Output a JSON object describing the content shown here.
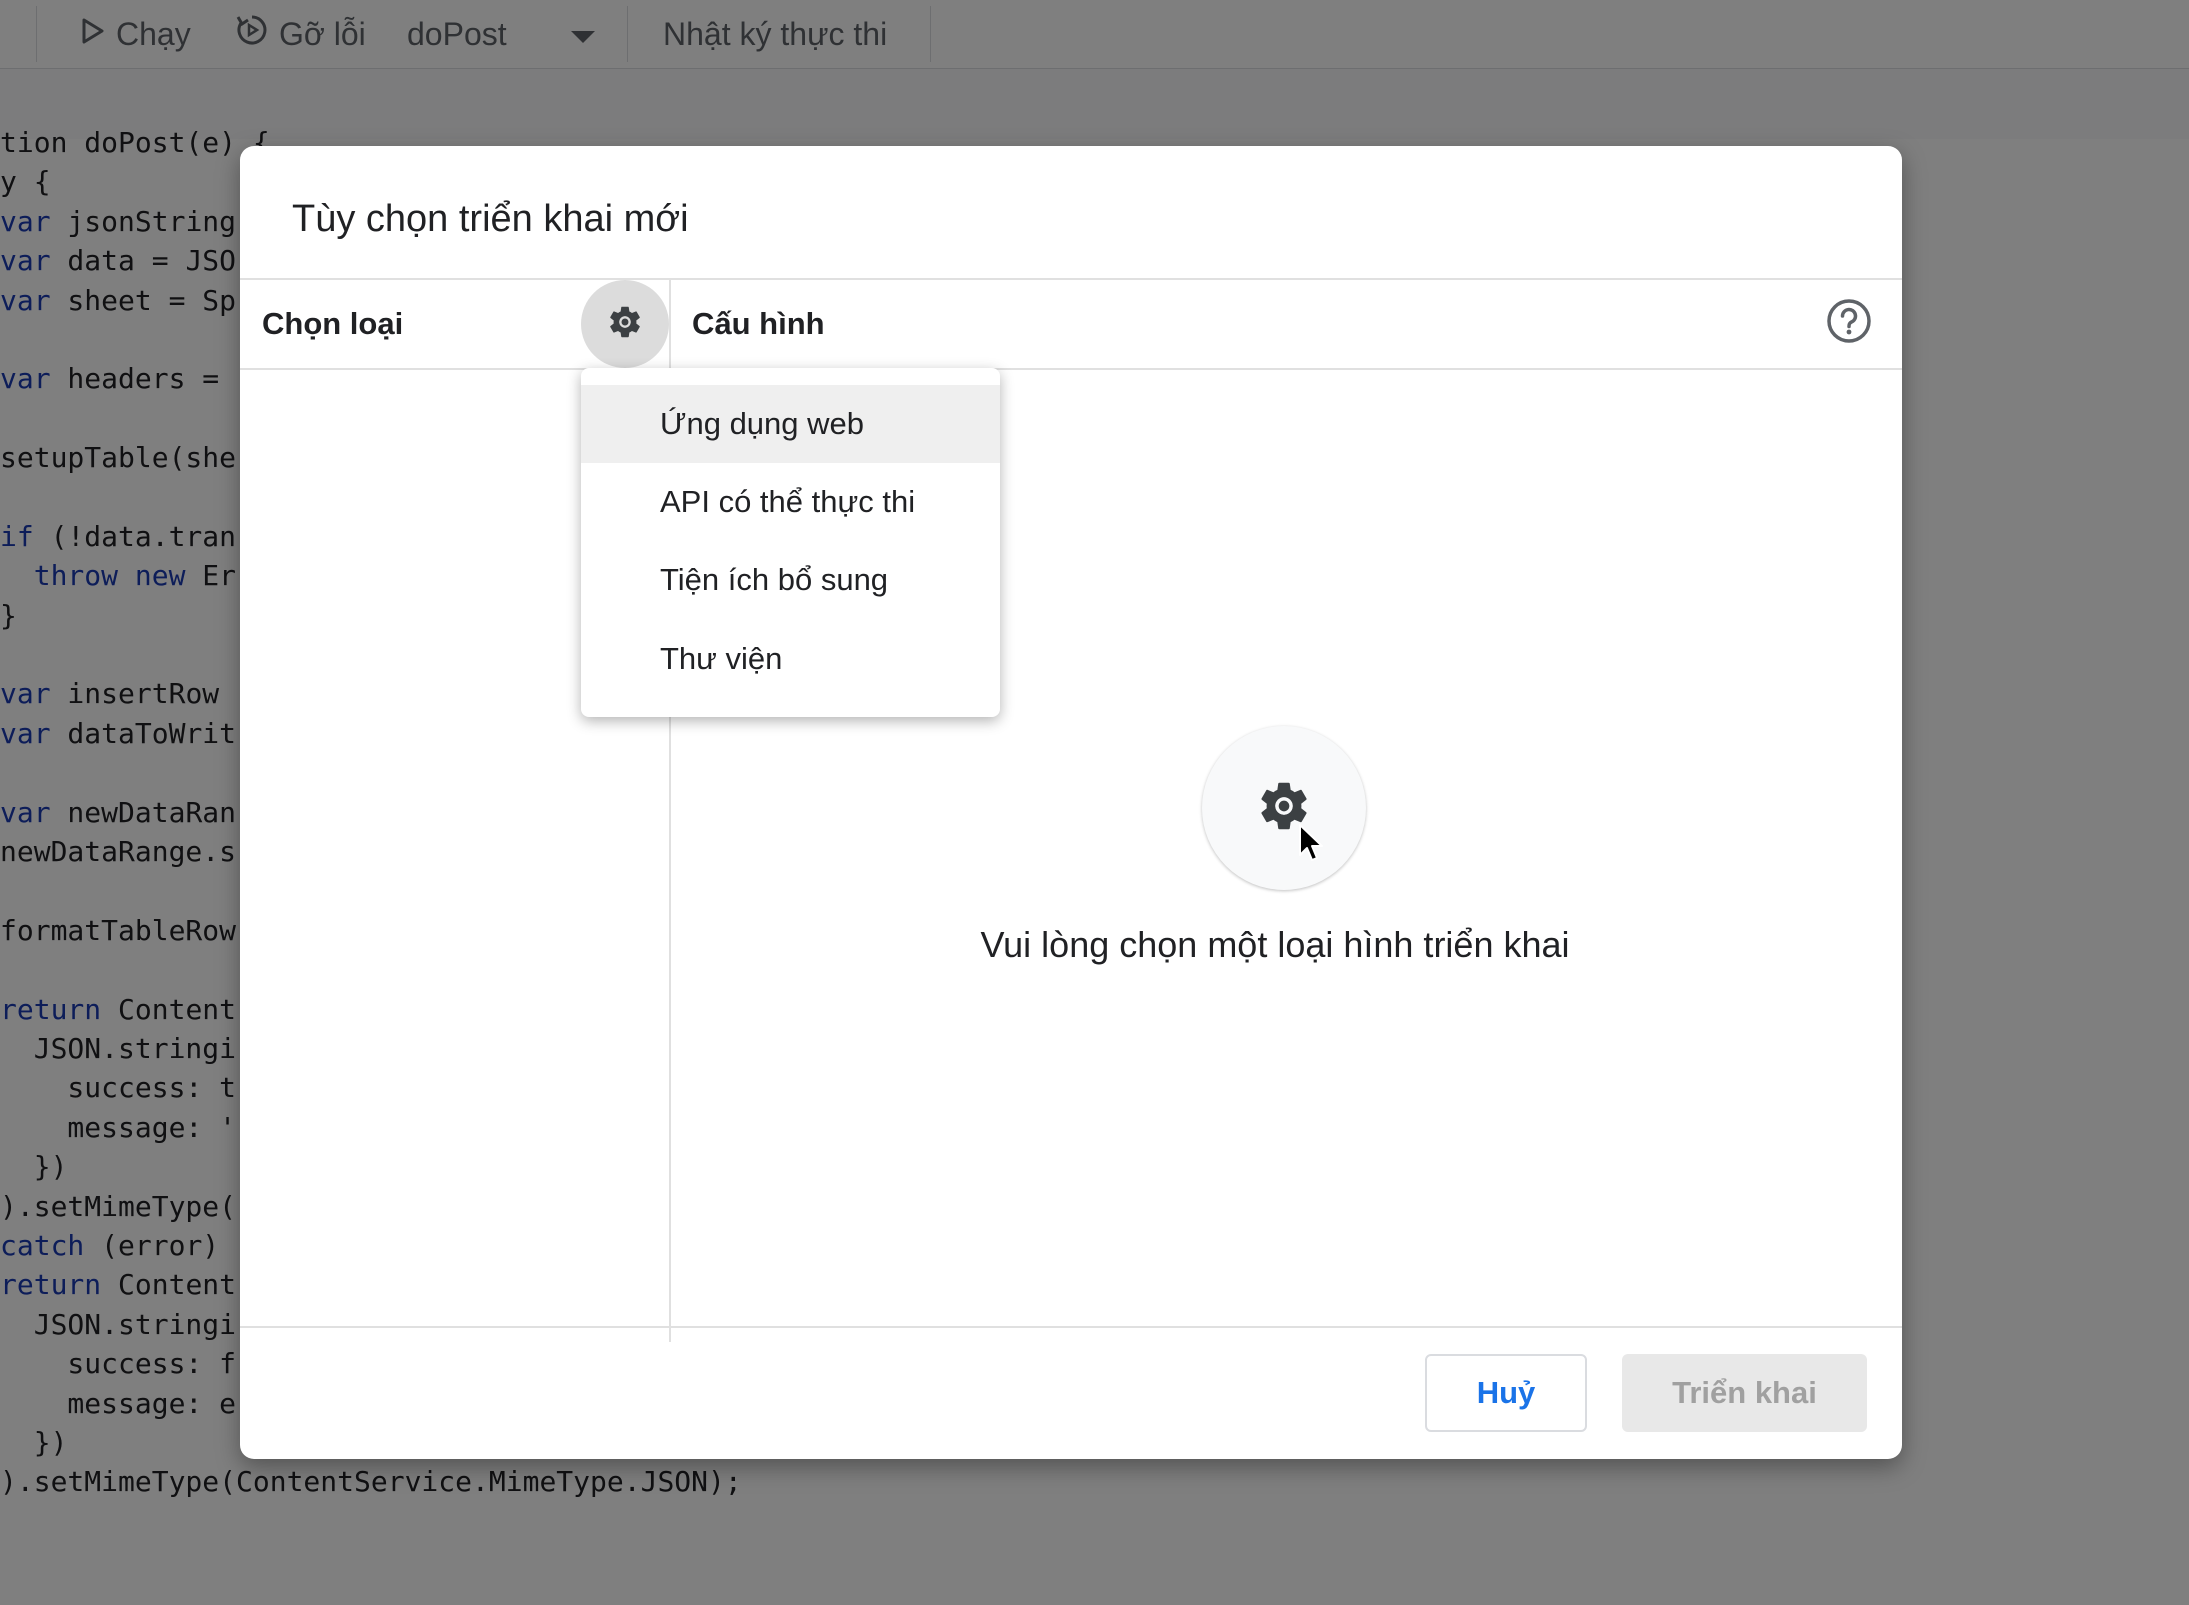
{
  "toolbar": {
    "run_label": "Chạy",
    "debug_label": "Gỡ lỗi",
    "function_select": "doPost",
    "log_label": "Nhật ký thực thi"
  },
  "code_lines": [
    "tion doPost(e) {",
    "y {",
    "var jsonString",
    "var data = JSO",
    "var sheet = Sp",
    "",
    "var headers =",
    "",
    "setupTable(she",
    "",
    "if (!data.tran",
    "  throw new Er",
    "}",
    "",
    "var insertRow",
    "var dataToWrit",
    "",
    "var newDataRan",
    "newDataRange.s",
    "",
    "formatTableRow",
    "",
    "return Content",
    "  JSON.stringi",
    "    success: t",
    "    message: '",
    "  })",
    ").setMimeType(",
    "catch (error)",
    "return Content",
    "  JSON.stringi",
    "    success: f",
    "    message: e",
    "  })",
    ").setMimeType(ContentService.MimeType.JSON);"
  ],
  "dialog": {
    "title": "Tùy chọn triển khai mới",
    "select_type_label": "Chọn loại",
    "config_label": "Cấu hình",
    "empty_message": "Vui lòng chọn một loại hình triển khai",
    "cancel_label": "Huỷ",
    "deploy_label": "Triển khai"
  },
  "menu": {
    "items": [
      {
        "label": "Ứng dụng web",
        "highlighted": true
      },
      {
        "label": "API có thể thực thi",
        "highlighted": false
      },
      {
        "label": "Tiện ích bổ sung",
        "highlighted": false
      },
      {
        "label": "Thư viện",
        "highlighted": false
      }
    ]
  },
  "icons": {
    "run": "play-icon",
    "debug": "debug-icon",
    "dropdown": "caret-down-icon",
    "settings": "gear-icon",
    "help": "help-circle-icon",
    "cursor": "mouse-pointer-icon"
  },
  "colors": {
    "accent": "#1a73e8",
    "scrim": "rgba(0,0,0,0.5)",
    "keyword": "#1a3bb3",
    "string": "#a31515"
  }
}
